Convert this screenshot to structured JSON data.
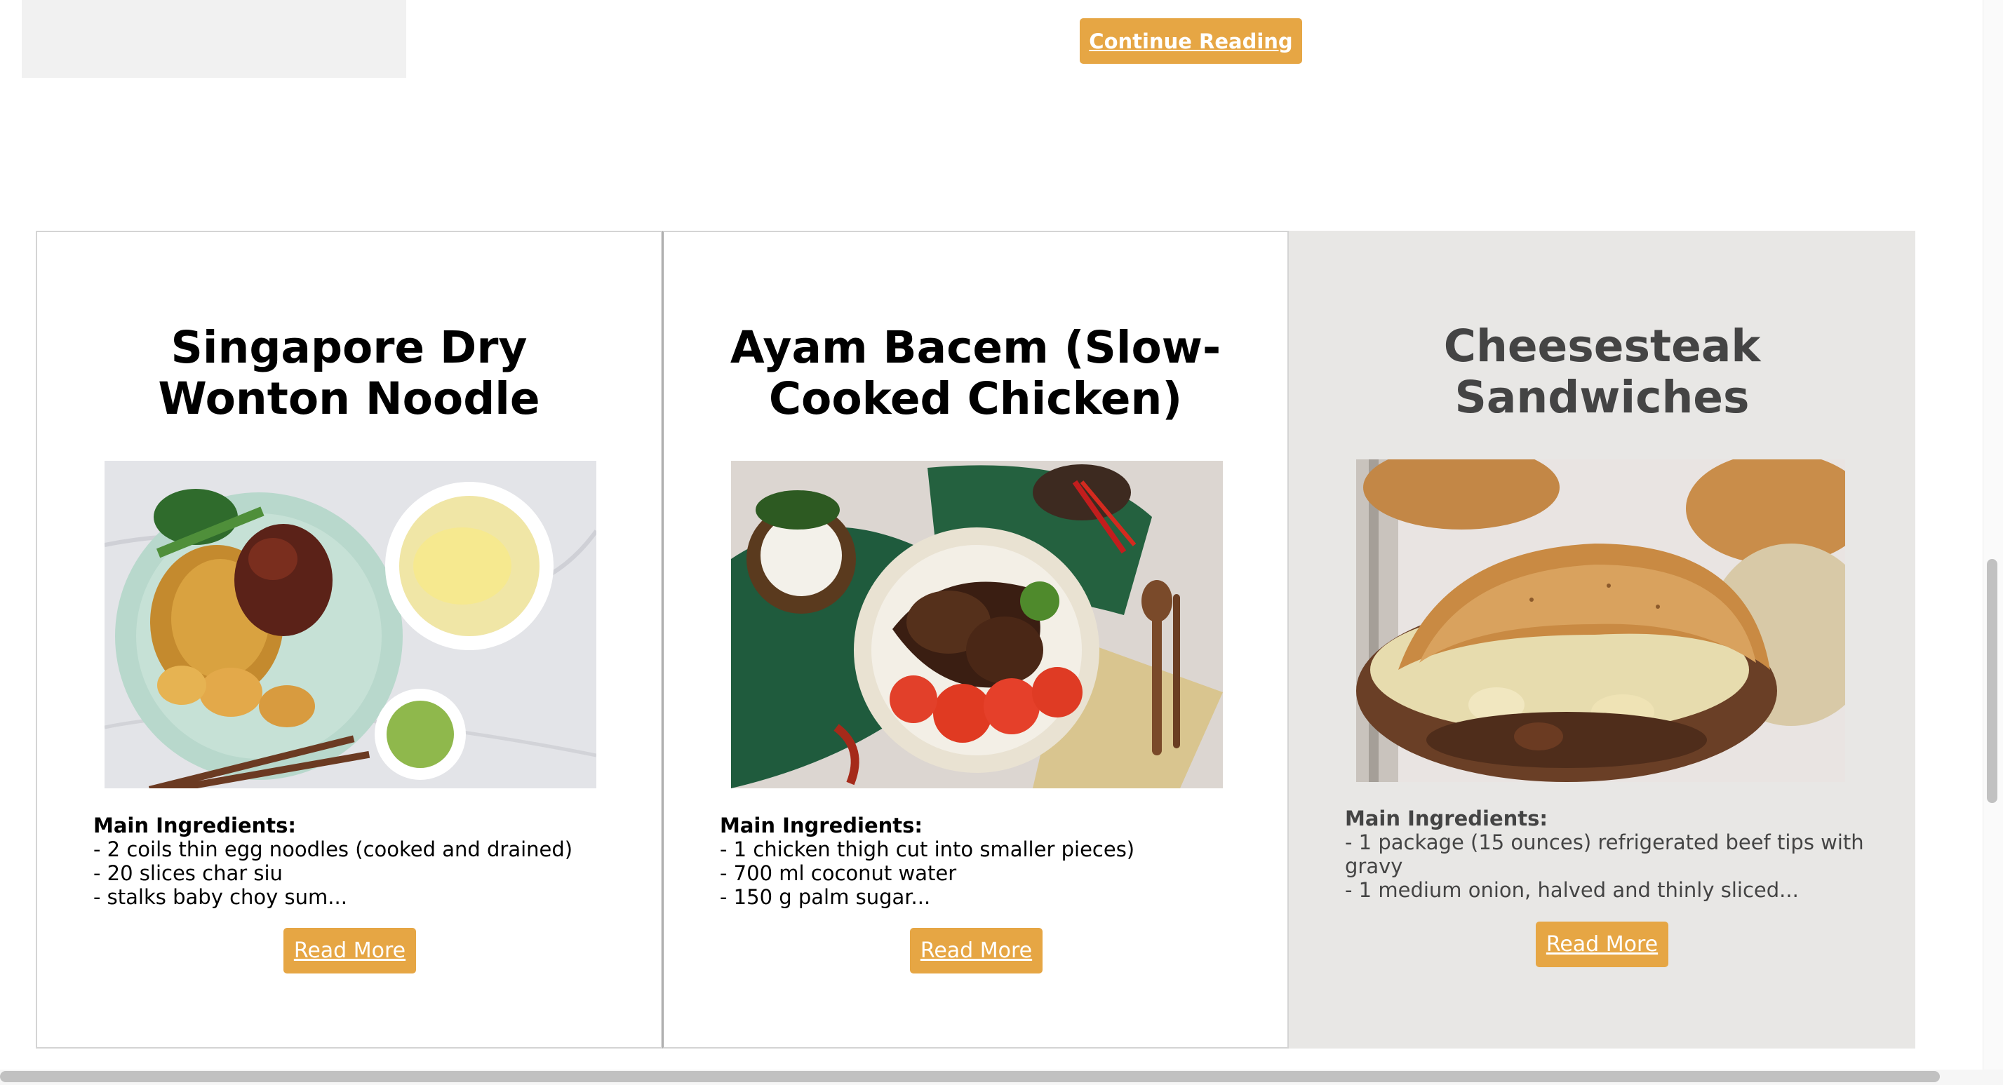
{
  "header": {
    "continue_label": "Continue Reading"
  },
  "cards": [
    {
      "title": "Singapore Dry Wonton Noodle",
      "image": "wonton-noodle-photo",
      "ingredients_heading": "Main Ingredients:",
      "ingredients": [
        "- 2 coils thin egg noodles (cooked and drained)",
        "- 20 slices char siu",
        "- stalks baby choy sum..."
      ],
      "read_more": "Read More"
    },
    {
      "title": "Ayam Bacem (Slow-Cooked Chicken)",
      "image": "ayam-bacem-photo",
      "ingredients_heading": "Main Ingredients:",
      "ingredients": [
        "- 1 chicken thigh cut into smaller pieces)",
        "- 700 ml coconut water",
        "- 150 g palm sugar..."
      ],
      "read_more": "Read More"
    },
    {
      "title": "Cheesesteak Sandwiches",
      "image": "cheesesteak-photo",
      "ingredients_heading": "Main Ingredients:",
      "ingredients": [
        "- 1 package (15 ounces) refrigerated beef tips with gravy",
        "- 1 medium onion, halved and thinly sliced..."
      ],
      "read_more": "Read More"
    }
  ],
  "colors": {
    "accent": "#e6a644",
    "hover_card": "#e8e7e5"
  }
}
